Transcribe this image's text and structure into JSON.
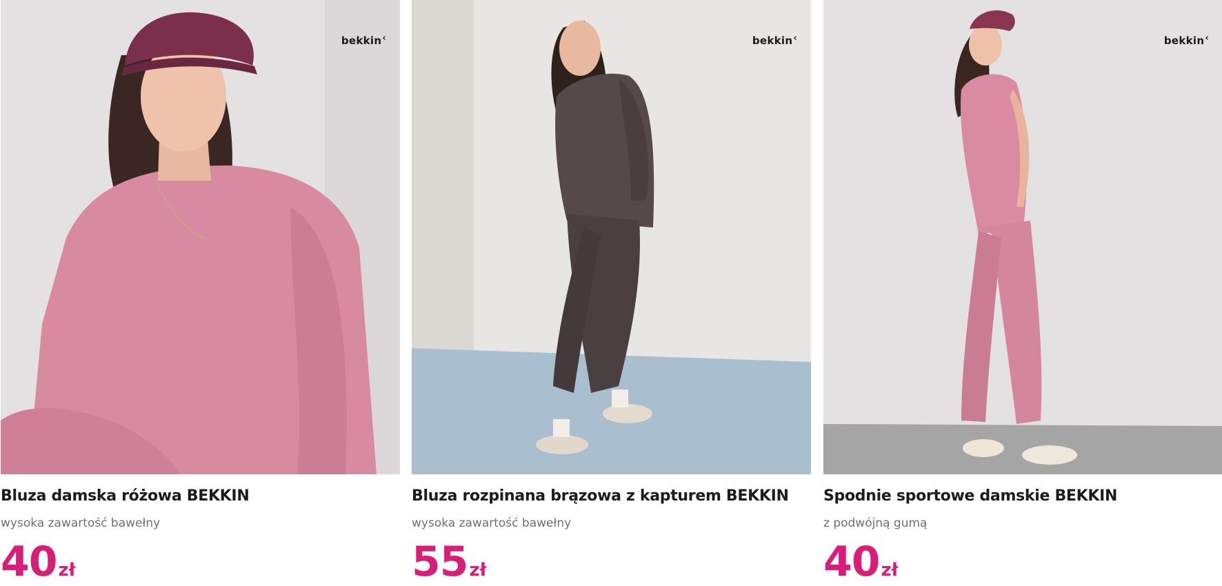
{
  "products": [
    {
      "brand_logo": "bekkin",
      "title": "Bluza damska różowa BEKKIN",
      "subtitle": "wysoka zawartość bawełny",
      "price": "40",
      "currency": "zł",
      "image_icon": "model-pink-sweatshirt-photo"
    },
    {
      "brand_logo": "bekkin",
      "title": "Bluza rozpinana brązowa z kapturem BEKKIN",
      "subtitle": "wysoka zawartość bawełny",
      "price": "55",
      "currency": "zł",
      "image_icon": "model-brown-hoodie-photo"
    },
    {
      "brand_logo": "bekkin",
      "title": "Spodnie sportowe damskie BEKKIN",
      "subtitle": "z podwójną gumą",
      "price": "40",
      "currency": "zł",
      "image_icon": "model-pink-joggers-photo"
    }
  ],
  "colors": {
    "price": "#d81e79",
    "title": "#1c1c1c",
    "subtitle": "#6f6f6f"
  }
}
